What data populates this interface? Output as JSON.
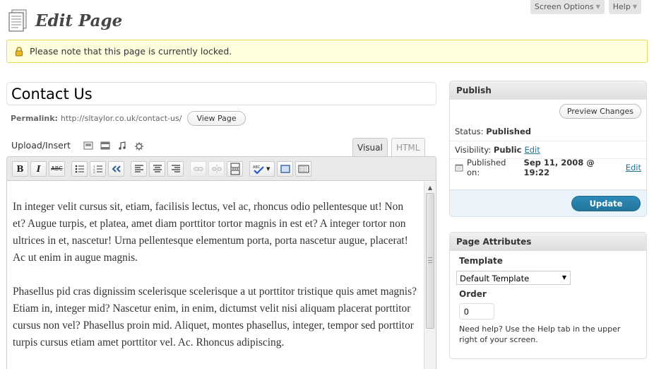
{
  "screen_tabs": {
    "screen_options": "Screen Options",
    "help": "Help"
  },
  "header": {
    "title": "Edit Page"
  },
  "notice": {
    "text": "Please note that this page is currently locked."
  },
  "post": {
    "title": "Contact Us",
    "permalink_label": "Permalink:",
    "permalink_url": "http://sltaylor.co.uk/contact-us/",
    "view_page": "View Page"
  },
  "editor": {
    "upload_label": "Upload/Insert",
    "tab_visual": "Visual",
    "tab_html": "HTML",
    "toolbar": {
      "bold": "B",
      "italic": "I",
      "strike": "ABC"
    },
    "paragraphs": [
      "In integer velit cursus sit, etiam, facilisis lectus, vel ac, rhoncus odio pellentesque ut! Non et? Augue turpis, et platea, amet diam porttitor tortor magnis in est et? A integer tortor non ultrices in et, nascetur! Urna pellentesque elementum porta, porta nascetur augue, placerat! Ac ut enim in augue magnis.",
      "Phasellus pid cras dignissim scelerisque scelerisque a ut porttitor tristique quis amet magnis? Etiam in, integer mid? Nascetur enim, in enim, dictumst velit nisi aliquam placerat porttitor cursus non vel? Phasellus proin mid. Aliquet, montes phasellus, integer, tempor sed porttitor turpis cursus etiam amet porttitor vel. Ac. Rhoncus adipiscing."
    ]
  },
  "publish": {
    "title": "Publish",
    "preview": "Preview Changes",
    "status_label": "Status:",
    "status_value": "Published",
    "visibility_label": "Visibility:",
    "visibility_value": "Public",
    "edit": "Edit",
    "published_label": "Published on:",
    "published_value": "Sep 11, 2008 @ 19:22",
    "update": "Update"
  },
  "attributes": {
    "title": "Page Attributes",
    "template_label": "Template",
    "template_value": "Default Template",
    "order_label": "Order",
    "order_value": "0",
    "help": "Need help? Use the Help tab in the upper right of your screen."
  },
  "colors": {
    "accent": "#21759b",
    "notice_bg": "#ffffe0",
    "notice_border": "#e6db55"
  }
}
